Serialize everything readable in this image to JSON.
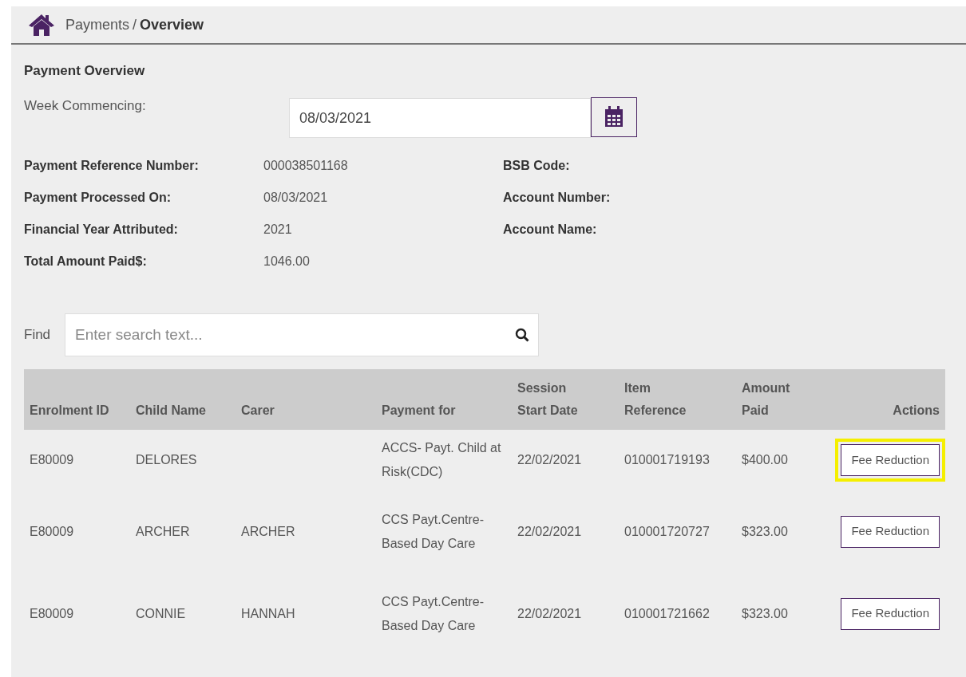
{
  "breadcrumb": {
    "parent": "Payments",
    "separator": "/",
    "current": "Overview"
  },
  "section_title": "Payment Overview",
  "week_commencing": {
    "label": "Week Commencing:",
    "value": "08/03/2021"
  },
  "details": [
    {
      "label": "Payment Reference Number:",
      "value": "000038501168"
    },
    {
      "label": "Payment Processed On:",
      "value": "08/03/2021"
    },
    {
      "label": "Financial Year Attributed:",
      "value": "2021"
    },
    {
      "label": "Total Amount Paid$:",
      "value": "1046.00"
    }
  ],
  "bank_details": [
    {
      "label": "BSB Code:"
    },
    {
      "label": "Account Number:"
    },
    {
      "label": "Account Name:"
    }
  ],
  "find": {
    "label": "Find",
    "placeholder": "Enter search text..."
  },
  "table": {
    "columns": [
      "Enrolment ID",
      "Child Name",
      "Carer",
      "Payment for",
      "Session Start Date",
      "Item Reference",
      "Amount Paid",
      "Actions"
    ],
    "rows": [
      {
        "enrolment_id": "E80009",
        "child_name": "DELORES",
        "carer": "",
        "payment_for": "ACCS- Payt. Child at Risk(CDC)",
        "session_start": "22/02/2021",
        "item_reference": "010001719193",
        "amount_paid": "$400.00",
        "action": "Fee Reduction",
        "highlighted": true
      },
      {
        "enrolment_id": "E80009",
        "child_name": "ARCHER",
        "carer": "ARCHER",
        "payment_for": "CCS Payt.Centre-Based Day Care",
        "session_start": "22/02/2021",
        "item_reference": "010001720727",
        "amount_paid": "$323.00",
        "action": "Fee Reduction",
        "highlighted": false
      },
      {
        "enrolment_id": "E80009",
        "child_name": "CONNIE",
        "carer": "HANNAH",
        "payment_for": "CCS Payt.Centre-Based Day Care",
        "session_start": "22/02/2021",
        "item_reference": "010001721662",
        "amount_paid": "$323.00",
        "action": "Fee Reduction",
        "highlighted": false
      }
    ]
  }
}
